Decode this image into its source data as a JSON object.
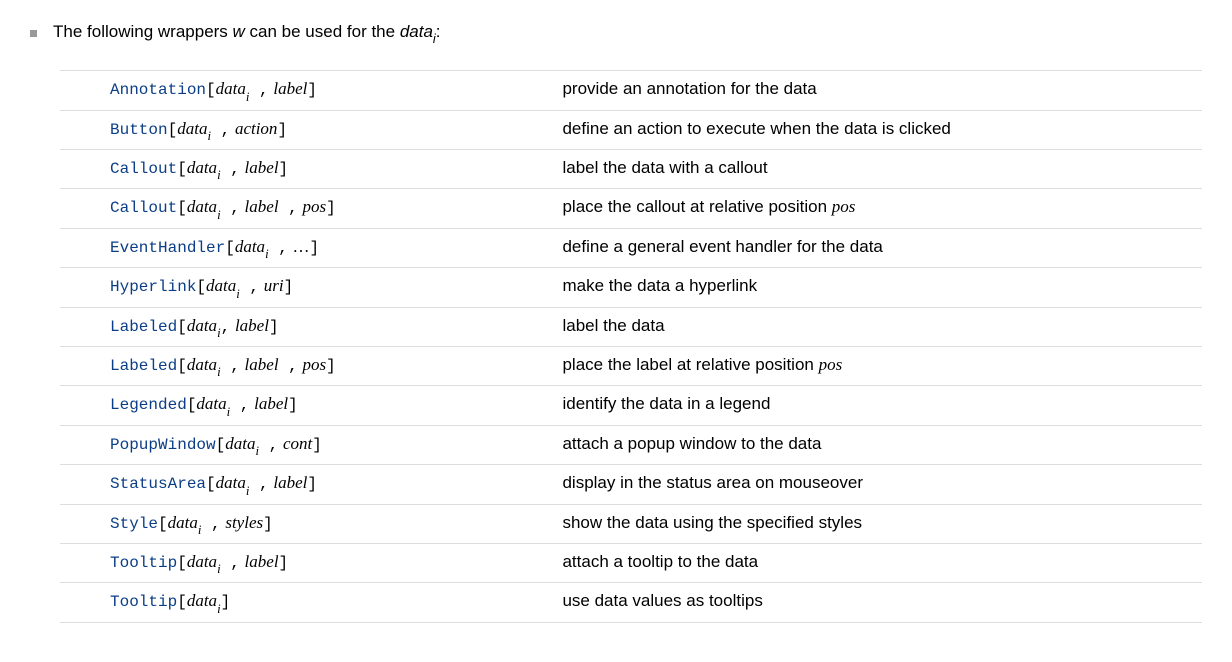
{
  "intro": {
    "text_before_w": "The following wrappers ",
    "w": "w",
    "text_mid": " can be used for the ",
    "data_word": "data",
    "data_sub": "i",
    "text_after": ":"
  },
  "rows": [
    {
      "symbol": "Annotation",
      "data_sub": "i",
      "args_after": [
        {
          "type": "sep",
          "text": ","
        },
        {
          "type": "space"
        },
        {
          "type": "arg",
          "text": "label"
        }
      ],
      "desc_parts": [
        {
          "type": "text",
          "text": "provide an annotation for the data"
        }
      ]
    },
    {
      "symbol": "Button",
      "data_sub": "i",
      "args_after": [
        {
          "type": "sep",
          "text": ","
        },
        {
          "type": "space"
        },
        {
          "type": "arg",
          "text": "action"
        }
      ],
      "desc_parts": [
        {
          "type": "text",
          "text": "define an action to execute when the data is clicked"
        }
      ]
    },
    {
      "symbol": "Callout",
      "data_sub": "i",
      "args_after": [
        {
          "type": "sep",
          "text": ","
        },
        {
          "type": "space"
        },
        {
          "type": "arg",
          "text": "label"
        }
      ],
      "desc_parts": [
        {
          "type": "text",
          "text": "label the data with a callout"
        }
      ]
    },
    {
      "symbol": "Callout",
      "data_sub": "i",
      "args_after": [
        {
          "type": "sep",
          "text": ","
        },
        {
          "type": "space"
        },
        {
          "type": "arg",
          "text": "label"
        },
        {
          "type": "sep",
          "text": ","
        },
        {
          "type": "space"
        },
        {
          "type": "arg",
          "text": "pos"
        }
      ],
      "desc_parts": [
        {
          "type": "text",
          "text": "place the callout at relative position "
        },
        {
          "type": "it",
          "text": "pos"
        }
      ]
    },
    {
      "symbol": "EventHandler",
      "data_sub": "i",
      "args_after": [
        {
          "type": "sep",
          "text": ","
        },
        {
          "type": "space"
        },
        {
          "type": "ell",
          "text": "…"
        }
      ],
      "desc_parts": [
        {
          "type": "text",
          "text": "define a general event handler for the data"
        }
      ]
    },
    {
      "symbol": "Hyperlink",
      "data_sub": "i",
      "args_after": [
        {
          "type": "sep",
          "text": ","
        },
        {
          "type": "space"
        },
        {
          "type": "arg",
          "text": "uri"
        }
      ],
      "desc_parts": [
        {
          "type": "text",
          "text": "make the data a hyperlink"
        }
      ]
    },
    {
      "symbol": "Labeled",
      "data_sub": "i",
      "args_after": [
        {
          "type": "sepns",
          "text": ","
        },
        {
          "type": "space"
        },
        {
          "type": "arg",
          "text": "label"
        }
      ],
      "desc_parts": [
        {
          "type": "text",
          "text": "label the data"
        }
      ]
    },
    {
      "symbol": "Labeled",
      "data_sub": "i",
      "args_after": [
        {
          "type": "sep",
          "text": ","
        },
        {
          "type": "space"
        },
        {
          "type": "arg",
          "text": "label"
        },
        {
          "type": "sep",
          "text": ","
        },
        {
          "type": "space"
        },
        {
          "type": "arg",
          "text": "pos"
        }
      ],
      "desc_parts": [
        {
          "type": "text",
          "text": "place the label at relative position "
        },
        {
          "type": "it",
          "text": "pos"
        }
      ]
    },
    {
      "symbol": "Legended",
      "data_sub": "i",
      "args_after": [
        {
          "type": "sep",
          "text": ","
        },
        {
          "type": "space"
        },
        {
          "type": "arg",
          "text": "label"
        }
      ],
      "desc_parts": [
        {
          "type": "text",
          "text": "identify the data in a legend"
        }
      ]
    },
    {
      "symbol": "PopupWindow",
      "data_sub": "i",
      "args_after": [
        {
          "type": "sep",
          "text": ","
        },
        {
          "type": "space"
        },
        {
          "type": "arg",
          "text": "cont"
        }
      ],
      "desc_parts": [
        {
          "type": "text",
          "text": "attach a popup window to the data"
        }
      ]
    },
    {
      "symbol": "StatusArea",
      "data_sub": "i",
      "args_after": [
        {
          "type": "sep",
          "text": ","
        },
        {
          "type": "space"
        },
        {
          "type": "arg",
          "text": "label"
        }
      ],
      "desc_parts": [
        {
          "type": "text",
          "text": "display in the status area on mouseover"
        }
      ]
    },
    {
      "symbol": "Style",
      "data_sub": "i",
      "args_after": [
        {
          "type": "sep",
          "text": ","
        },
        {
          "type": "space"
        },
        {
          "type": "arg",
          "text": "styles"
        }
      ],
      "desc_parts": [
        {
          "type": "text",
          "text": "show the data using the specified styles"
        }
      ]
    },
    {
      "symbol": "Tooltip",
      "data_sub": "i",
      "args_after": [
        {
          "type": "sep",
          "text": ","
        },
        {
          "type": "space"
        },
        {
          "type": "arg",
          "text": "label"
        }
      ],
      "desc_parts": [
        {
          "type": "text",
          "text": "attach a tooltip to the data"
        }
      ]
    },
    {
      "symbol": "Tooltip",
      "data_sub": "i",
      "args_after": [],
      "desc_parts": [
        {
          "type": "text",
          "text": "use data values as tooltips"
        }
      ]
    }
  ],
  "shared": {
    "data_word": "data",
    "open_bracket": "[",
    "close_bracket": "]"
  }
}
